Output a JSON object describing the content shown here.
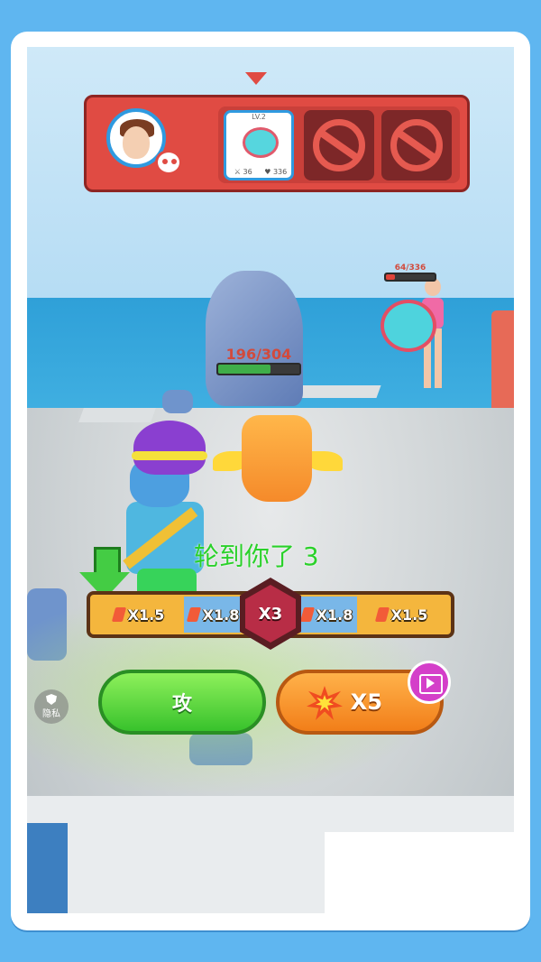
{
  "team_bar": {
    "active_slot": {
      "level": "LV.2",
      "attack": "36",
      "hp": "336"
    },
    "locked_slots": 2
  },
  "player_pet_hp": {
    "current": 196,
    "max": 304,
    "text": "196/304"
  },
  "enemy_pet_hp": {
    "current": 64,
    "max": 336,
    "text": "64/336"
  },
  "turn_text": "轮到你了 3",
  "multipliers": [
    "X1.5",
    "X1.8",
    "X3",
    "X1.8",
    "X1.5"
  ],
  "buttons": {
    "attack": "攻",
    "power": "X5"
  },
  "privacy_label": "隐私",
  "colors": {
    "hp_green": "#3fae49",
    "hp_red": "#e0443a",
    "turn_text": "#2ad12a",
    "attack_button": "#38c22c",
    "power_button": "#f27e19"
  }
}
